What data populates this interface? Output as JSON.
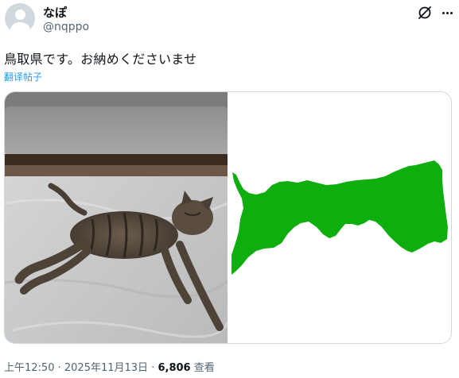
{
  "author": {
    "display_name": "なぽ",
    "handle": "@nqppo"
  },
  "tweet": {
    "text": "鳥取県です。お納めくださいませ",
    "translate_label": "翻译帖子"
  },
  "media": {
    "left_image": "cat-photo",
    "right_image": "tottori-prefecture-map",
    "map_color": "#0fae0f"
  },
  "meta": {
    "time": "上午12:50",
    "sep1": "·",
    "date": "2025年11月13日",
    "sep2": "·",
    "views_count": "6,806",
    "views_label": "查看"
  },
  "icons": {
    "grok": "grok-icon",
    "more": "more-icon"
  }
}
